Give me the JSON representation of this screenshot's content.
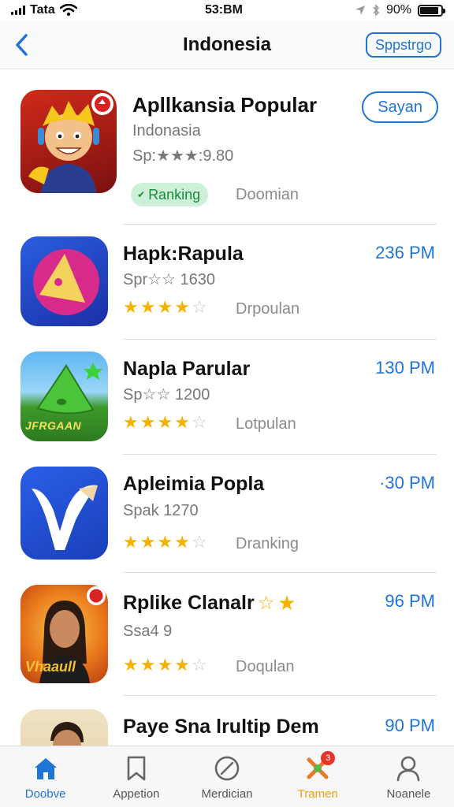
{
  "status_bar": {
    "carrier": "Tata",
    "time": "53:BM",
    "battery": "90%",
    "battery_fraction": 0.9
  },
  "nav": {
    "title": "Indonesia",
    "action_label": "Sppstrgo"
  },
  "featured": {
    "title": "Apllkansia Popular",
    "subtitle": "Indonasia",
    "rating_text": "Sp:★★★:9.80",
    "badge": "Ranking",
    "status": "Doomian",
    "button_label": "Sayan"
  },
  "apps": [
    {
      "title": "Hapk:Rapula",
      "sub": "Spr☆☆ 1630",
      "time": "236 PM",
      "status": "Drpoulan",
      "rating": 4
    },
    {
      "title": "Napla Parular",
      "sub": "Sp☆☆ 1200",
      "time": "130 PM",
      "status": "Lotpulan",
      "rating": 4,
      "icon_text": "JFRGAAN"
    },
    {
      "title": "Apleimia Popla",
      "sub": "Spak 1270",
      "time": "·30 PM",
      "status": "Dranking",
      "rating": 4
    },
    {
      "title": "Rplike Clanalr",
      "sub": "Ssa4 9",
      "time": "96 PM",
      "status": "Doqulan",
      "rating": 4,
      "icon_text": "Vhaaull"
    },
    {
      "title": "Paye Sna lrultip Dem",
      "time": "90 PM"
    }
  ],
  "tabs": [
    {
      "label": "Doobve",
      "icon": "home-icon"
    },
    {
      "label": "Appetion",
      "icon": "bookmark-icon"
    },
    {
      "label": "Merdician",
      "icon": "compass-icon"
    },
    {
      "label": "Tramen",
      "icon": "games-icon",
      "badge": "3"
    },
    {
      "label": "Noanele",
      "icon": "person-icon"
    }
  ],
  "colors": {
    "accent": "#1f74d6",
    "star": "#f5b301",
    "badge_bg": "#cdf1d8",
    "badge_text": "#1d8a3a",
    "tab_orange": "#f5a300"
  }
}
